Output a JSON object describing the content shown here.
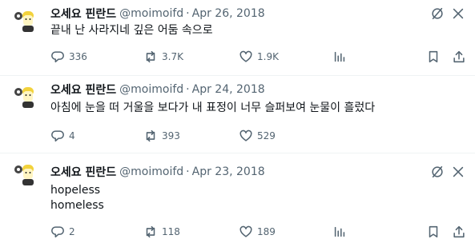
{
  "tweets": [
    {
      "name": "오세요 핀란드",
      "handle": "@moimoifd",
      "separator": "·",
      "date": "Apr 26, 2018",
      "lines": [
        "끝내 난 사라지네 깊은 어둠 속으로"
      ],
      "replies": "336",
      "retweets": "3.7K",
      "likes": "1.9K"
    },
    {
      "name": "오세요 핀란드",
      "handle": "@moimoifd",
      "separator": "·",
      "date": "Apr 24, 2018",
      "lines": [
        "아침에 눈을 떠 거울을 보다가 내 표정이 너무 슬퍼보여 눈물이 흘렀다"
      ],
      "replies": "4",
      "retweets": "393",
      "likes": "529"
    },
    {
      "name": "오세요 핀란드",
      "handle": "@moimoifd",
      "separator": "·",
      "date": "Apr 23, 2018",
      "lines": [
        "hopeless",
        "homeless"
      ],
      "replies": "2",
      "retweets": "118",
      "likes": "189"
    }
  ],
  "icons": {
    "top": [
      "grok-icon",
      "more-icon"
    ],
    "actions": [
      "reply-icon",
      "retweet-icon",
      "like-icon",
      "views-icon",
      "bookmark-icon",
      "share-icon"
    ]
  },
  "colors": {
    "text": "#0f1419",
    "secondary": "#536471",
    "divider": "#eff3f4",
    "avatar_bg": "#fff5c2"
  }
}
